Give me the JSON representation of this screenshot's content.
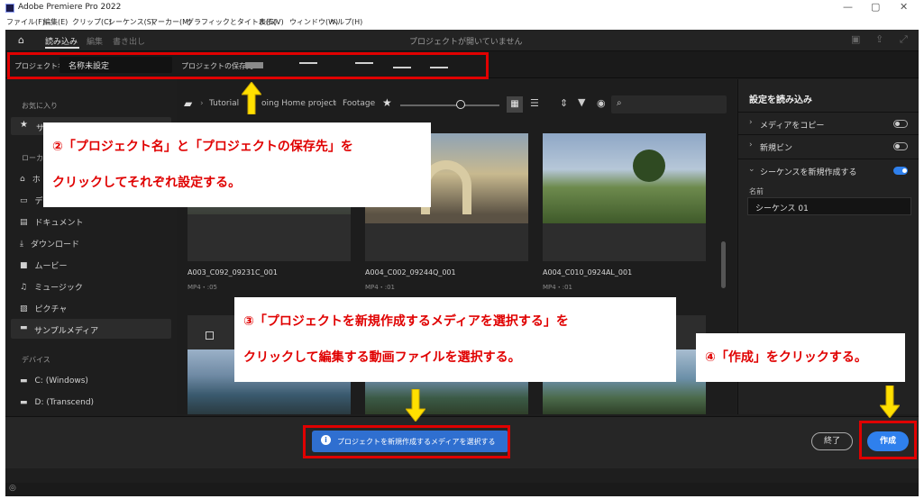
{
  "window": {
    "title": "Adobe Premiere Pro 2022",
    "min": "—",
    "max": "▢",
    "close": "✕"
  },
  "menu": [
    "ファイル(F)",
    "編集(E)",
    "クリップ(C)",
    "シーケンス(S)",
    "マーカー(M)",
    "グラフィックとタイトル(G)",
    "表示(V)",
    "ウィンドウ(W)",
    "ヘルプ(H)"
  ],
  "nav": {
    "import": "読み込み",
    "edit": "編集",
    "export": "書き出し",
    "status": "プロジェクトが開いていません"
  },
  "project": {
    "name_label": "プロジェクト名",
    "name_value": "名称未設定",
    "location_label": "プロジェクトの保存先"
  },
  "sidebar": {
    "favorites": "お気に入り",
    "fav_item": "サ",
    "local": "ローカル",
    "home": "ホ",
    "desktop": "デ",
    "documents": "ドキュメント",
    "downloads": "ダウンロード",
    "movies": "ムービー",
    "music": "ミュージック",
    "pictures": "ピクチャ",
    "sample": "サンプルメディア",
    "devices": "デバイス",
    "drive_c": "C: (Windows)",
    "drive_d": "D: (Transcend)"
  },
  "breadcrumb": [
    "Tutorial",
    "oing Home project",
    "Footage"
  ],
  "clips": [
    {
      "name": "A003_C092_09231C_001",
      "meta": "MP4・:05"
    },
    {
      "name": "A004_C002_09244Q_001",
      "meta": "MP4・:01"
    },
    {
      "name": "A004_C010_0924AL_001",
      "meta": "MP4・:01"
    }
  ],
  "right": {
    "title": "設定を読み込み",
    "copy_media": "メディアをコピー",
    "new_bin": "新規ビン",
    "new_sequence": "シーケンスを新規作成する",
    "name_label": "名前",
    "seq_name": "シーケンス 01"
  },
  "bottom": {
    "select_media": "プロジェクトを新規作成するメディアを選択する",
    "exit": "終了",
    "create": "作成"
  },
  "callouts": {
    "c2_line1": "②「プロジェクト名」と「プロジェクトの保存先」を",
    "c2_line2": "クリックしてそれぞれ設定する。",
    "c3_line1": "③「プロジェクトを新規作成するメディアを選択する」を",
    "c3_line2": "クリックして編集する動画ファイルを選択する。",
    "c4": "④「作成」をクリックする。"
  },
  "colors": {
    "accent": "#2f80ed",
    "annotation": "#e00000",
    "arrow": "#ffe000"
  }
}
